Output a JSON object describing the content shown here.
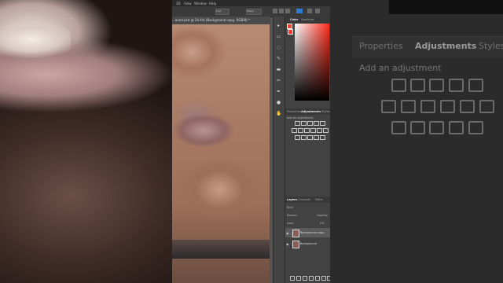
{
  "menubar": {
    "items": [
      "3D",
      "View",
      "Window",
      "Help"
    ]
  },
  "options_bar": {
    "field1": "0 pt",
    "field2": "Sharp",
    "swatch_color": "#2d7dd8"
  },
  "document_tab": {
    "title": "...ound.psd @ 24.4% (Background copy, RGB/8) *"
  },
  "color_panel": {
    "tabs": [
      "Color",
      "Swatches"
    ],
    "foreground": "#ee3322"
  },
  "adjustments_panel": {
    "tabs": [
      "Properties",
      "Adjustments",
      "Styles"
    ],
    "active_tab": "Adjustments",
    "add_label": "Add an adjustment"
  },
  "layers_panel": {
    "tabs": [
      "Layers",
      "Channels",
      "Paths"
    ],
    "kind_label": "Kind",
    "blend_mode": "Normal",
    "opacity_label": "Opacity:",
    "lock_label": "Lock:",
    "fill_label": "Fill:",
    "layers": [
      {
        "name": "Background copy",
        "visible": true,
        "selected": true
      },
      {
        "name": "Background",
        "visible": true,
        "selected": false
      }
    ]
  },
  "right_enlarged": {
    "tabs": [
      "Properties",
      "Adjustments",
      "Styles"
    ],
    "add_label": "Add an adjustment"
  }
}
